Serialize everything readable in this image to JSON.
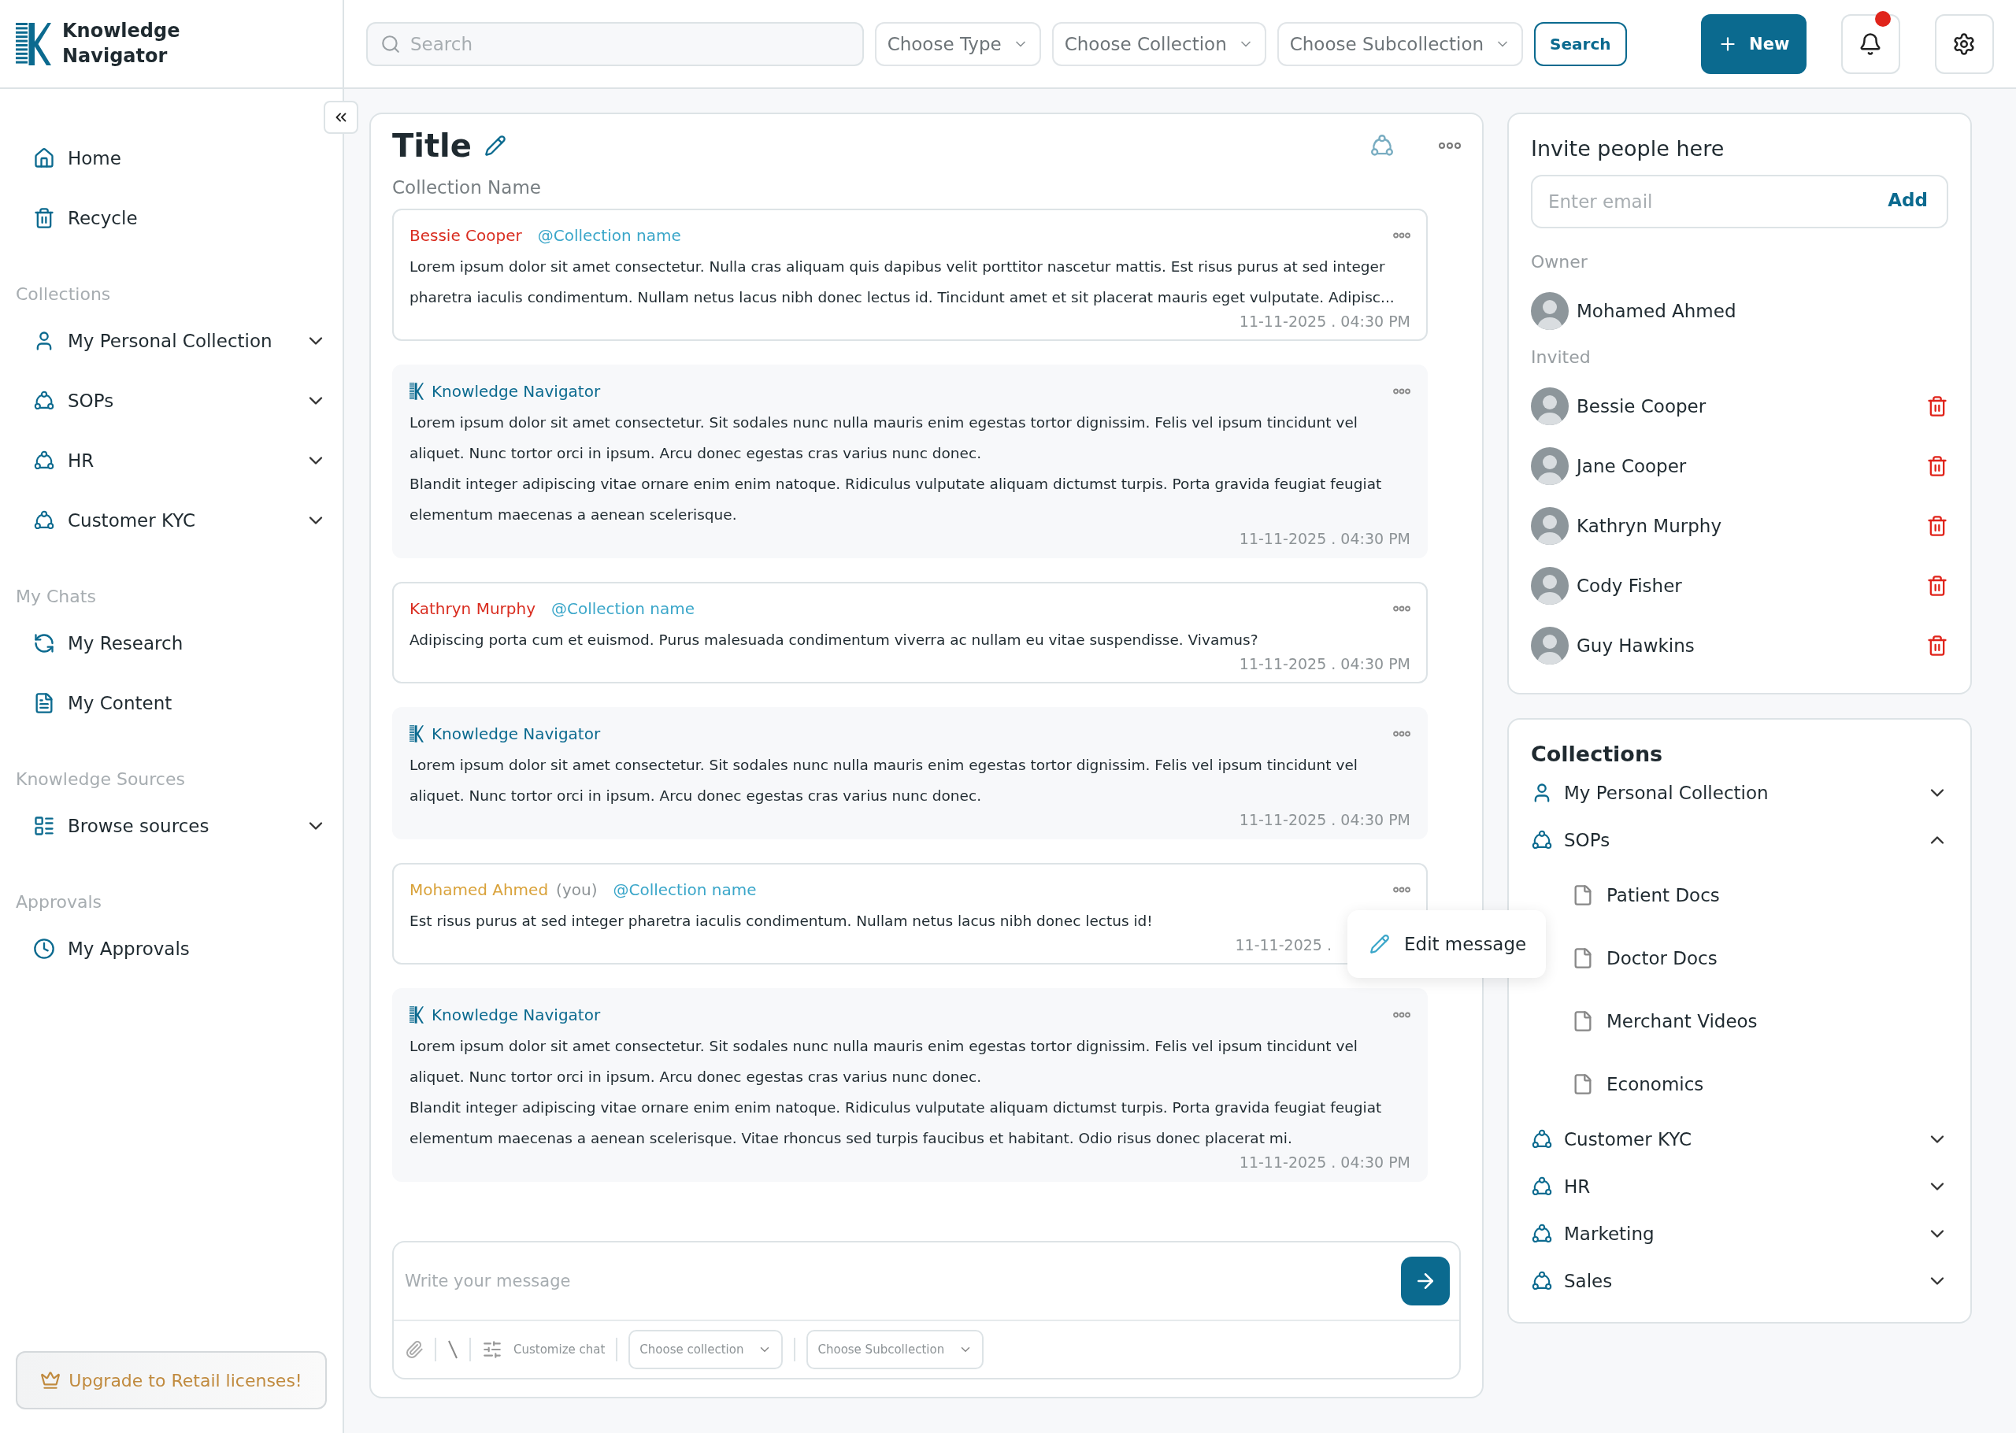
{
  "brand": {
    "name": "Knowledge Navigator"
  },
  "sidebar": {
    "items": [
      {
        "label": "Home",
        "kind": "home"
      },
      {
        "label": "Recycle",
        "kind": "trash"
      }
    ],
    "groups": [
      {
        "heading": "Collections",
        "items": [
          {
            "label": "My Personal Collection",
            "kind": "person",
            "expanded": false
          },
          {
            "label": "SOPs",
            "kind": "group",
            "expanded": false
          },
          {
            "label": "HR",
            "kind": "group",
            "expanded": false
          },
          {
            "label": "Customer KYC",
            "kind": "group",
            "expanded": false
          }
        ]
      },
      {
        "heading": "My Chats",
        "items": [
          {
            "label": "My Research",
            "kind": "research"
          },
          {
            "label": "My Content",
            "kind": "content"
          }
        ]
      },
      {
        "heading": "Knowledge Sources",
        "items": [
          {
            "label": "Browse sources",
            "kind": "sources",
            "expanded": false
          }
        ]
      },
      {
        "heading": "Approvals",
        "items": [
          {
            "label": "My Approvals",
            "kind": "clock"
          }
        ]
      }
    ],
    "upgrade_button": "Upgrade to Retail licenses!"
  },
  "topbar": {
    "search_placeholder": "Search",
    "filters": [
      "Choose Type",
      "Choose Collection",
      "Choose Subcollection"
    ],
    "search_button": "Search",
    "new_button": "New",
    "unread_notifications": true
  },
  "chat": {
    "title": "Title",
    "subtitle": "Collection Name",
    "messages": [
      {
        "kind": "user",
        "author": "Bessie Cooper",
        "color": "#d92d20",
        "mention": "@Collection name",
        "paragraphs": [
          "Lorem ipsum dolor sit amet consectetur. Nulla cras aliquam quis dapibus velit porttitor nascetur mattis. Est risus purus at sed integer pharetra iaculis condimentum. Nullam netus lacus nibh donec lectus id. Tincidunt amet et sit placerat mauris eget vulputate. Adipisc..."
        ],
        "time": "11-11-2025 . 04:30 PM"
      },
      {
        "kind": "bot",
        "author": "Knowledge Navigator",
        "paragraphs": [
          "Lorem ipsum dolor sit amet consectetur. Sit sodales nunc nulla mauris enim egestas tortor dignissim. Felis vel ipsum tincidunt vel aliquet. Nunc tortor orci in ipsum. Arcu donec egestas cras varius nunc donec.",
          "Blandit integer adipiscing vitae ornare enim enim natoque. Ridiculus vulputate aliquam dictumst turpis. Porta gravida feugiat feugiat elementum maecenas a aenean scelerisque."
        ],
        "time": "11-11-2025 . 04:30 PM"
      },
      {
        "kind": "user",
        "author": "Kathryn Murphy",
        "color": "#d92d20",
        "mention": "@Collection name",
        "paragraphs": [
          "Adipiscing porta cum et euismod. Purus malesuada condimentum viverra ac nullam eu vitae suspendisse. Vivamus?"
        ],
        "time": "11-11-2025 . 04:30 PM"
      },
      {
        "kind": "bot",
        "author": "Knowledge Navigator",
        "paragraphs": [
          "Lorem ipsum dolor sit amet consectetur. Sit sodales nunc nulla mauris enim egestas tortor dignissim. Felis vel ipsum tincidunt vel aliquet. Nunc tortor orci in ipsum. Arcu donec egestas cras varius nunc donec."
        ],
        "time": "11-11-2025 . 04:30 PM"
      },
      {
        "kind": "user",
        "author": "Mohamed Ahmed",
        "suffix": "(you)",
        "color": "#d9a23a",
        "mention": "@Collection name",
        "paragraphs": [
          "Est risus purus at sed integer pharetra iaculis condimentum. Nullam netus lacus nibh donec lectus id!"
        ],
        "time": "11-11-2025 .",
        "context_menu": {
          "label": "Edit message"
        }
      },
      {
        "kind": "bot",
        "author": "Knowledge Navigator",
        "paragraphs": [
          "Lorem ipsum dolor sit amet consectetur. Sit sodales nunc nulla mauris enim egestas tortor dignissim. Felis vel ipsum tincidunt vel aliquet. Nunc tortor orci in ipsum. Arcu donec egestas cras varius nunc donec.",
          "Blandit integer adipiscing vitae ornare enim enim natoque. Ridiculus vulputate aliquam dictumst turpis. Porta gravida feugiat feugiat elementum maecenas a aenean scelerisque. Vitae rhoncus sed turpis faucibus et habitant. Odio risus donec placerat mi."
        ],
        "time": "11-11-2025 . 04:30 PM"
      }
    ],
    "composer": {
      "placeholder": "Write your message",
      "customize": "Customize chat",
      "selects": [
        "Choose collection",
        "Choose Subcollection"
      ]
    }
  },
  "invite": {
    "title": "Invite people here",
    "placeholder": "Enter email",
    "add_button": "Add",
    "owner_heading": "Owner",
    "owner": {
      "name": "Mohamed Ahmed"
    },
    "invited_heading": "Invited",
    "invited": [
      {
        "name": "Bessie Cooper"
      },
      {
        "name": "Jane Cooper"
      },
      {
        "name": "Kathryn Murphy"
      },
      {
        "name": "Cody Fisher"
      },
      {
        "name": "Guy Hawkins"
      }
    ]
  },
  "collections": {
    "title": "Collections",
    "items": [
      {
        "label": "My Personal Collection",
        "kind": "person",
        "expanded": false
      },
      {
        "label": "SOPs",
        "kind": "group",
        "expanded": true,
        "children": [
          {
            "label": "Patient Docs"
          },
          {
            "label": "Doctor Docs"
          },
          {
            "label": "Merchant Videos"
          },
          {
            "label": "Economics"
          }
        ]
      },
      {
        "label": "Customer KYC",
        "kind": "group",
        "expanded": false
      },
      {
        "label": "HR",
        "kind": "group",
        "expanded": false
      },
      {
        "label": "Marketing",
        "kind": "group",
        "expanded": false
      },
      {
        "label": "Sales",
        "kind": "group",
        "expanded": false
      }
    ]
  }
}
